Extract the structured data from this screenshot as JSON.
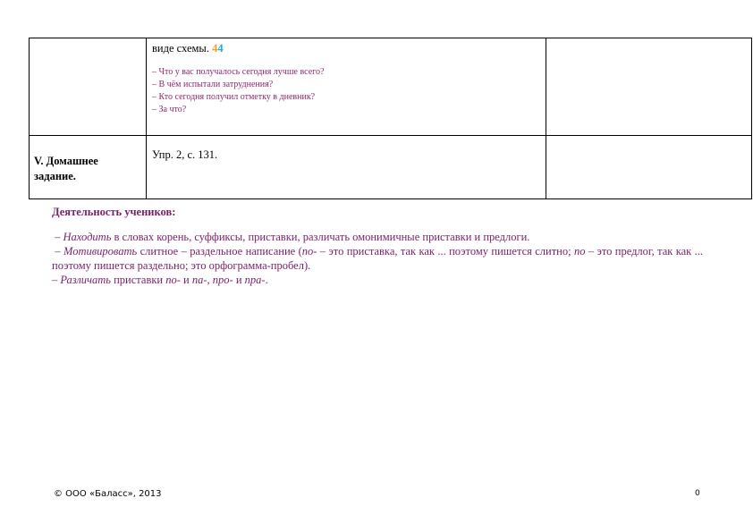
{
  "table": {
    "row1": {
      "col2_text": "виде схемы.",
      "badge_orange": "4",
      "badge_blue": "4",
      "questions": [
        "– Что у вас получалось сегодня лучше всего?",
        "– В чём испытали затруднения?",
        "– Кто сегодня получил отметку в дневник?",
        "– За что?"
      ]
    },
    "row2": {
      "stage_line1": "V. Домашнее",
      "stage_line2": "задание.",
      "homework": "Упр. 2, с. 131."
    }
  },
  "activity": {
    "heading": "Деятельность учеников:",
    "items": [
      {
        "verb": "– Находить",
        "text": " в словах корень, суффиксы, приставки, различать омонимичные приставки и предлоги."
      },
      {
        "verb": "– Мотивировать",
        "text_a": " слитное – раздельное написание (",
        "term1": "по-",
        "text_b": " – это приставка, так как ... поэтому пишется слитно; ",
        "term2": "по",
        "text_c": " – это предлог, так как ... поэтому пишется раздельно; это орфограмма-пробел)."
      },
      {
        "verb": "– Различать",
        "text_a": " приставки ",
        "t1": "по-",
        "and1": " и ",
        "t2": "па-",
        "comma": ", ",
        "t3": "про-",
        "and2": " и ",
        "t4": "пра-",
        "end": "."
      }
    ]
  },
  "footer": {
    "copyright": "© ООО «Баласс», 2013",
    "page_number": "0"
  }
}
